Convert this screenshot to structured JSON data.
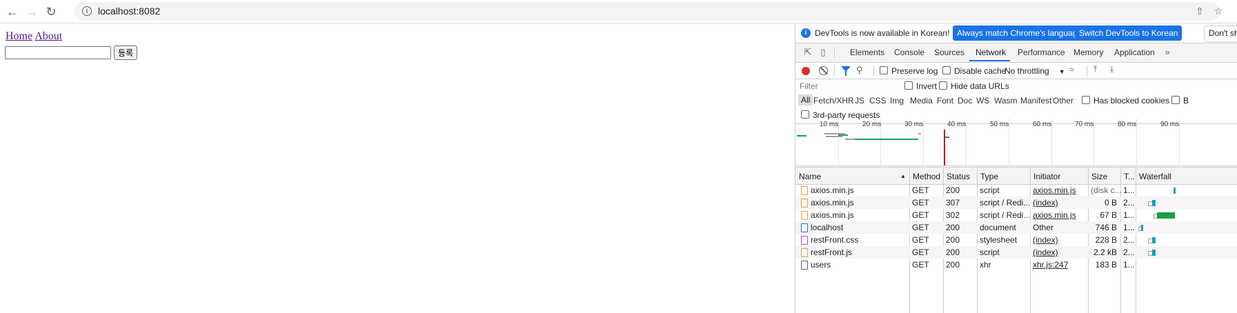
{
  "browser": {
    "url": "localhost:8082"
  },
  "page": {
    "links": [
      {
        "label": "Home"
      },
      {
        "label": "About"
      }
    ],
    "input_value": "",
    "submit_label": "등록"
  },
  "devtools": {
    "infobar": {
      "message": "DevTools is now available in Korean!",
      "btn_match": "Always match Chrome's language",
      "btn_switch": "Switch DevTools to Korean",
      "btn_dont": "Don't sh"
    },
    "tabs": [
      "Elements",
      "Console",
      "Sources",
      "Network",
      "Performance",
      "Memory",
      "Application"
    ],
    "active_tab": "Network",
    "toolbar": {
      "preserve_log": "Preserve log",
      "disable_cache": "Disable cache",
      "throttling": "No throttling"
    },
    "filter": {
      "placeholder": "Filter",
      "invert": "Invert",
      "hide_data_urls": "Hide data URLs"
    },
    "types": [
      "All",
      "Fetch/XHR",
      "JS",
      "CSS",
      "Img",
      "Media",
      "Font",
      "Doc",
      "WS",
      "Wasm",
      "Manifest",
      "Other"
    ],
    "has_blocked_cookies": "Has blocked cookies",
    "blocked_partial": "B",
    "third_party": "3rd-party requests",
    "timeline_ticks": [
      "10 ms",
      "20 ms",
      "30 ms",
      "40 ms",
      "50 ms",
      "60 ms",
      "70 ms",
      "80 ms",
      "90 ms"
    ],
    "columns": [
      "Name",
      "Method",
      "Status",
      "Type",
      "Initiator",
      "Size",
      "T...",
      "Waterfall"
    ],
    "rows": [
      {
        "name": "axios.min.js",
        "method": "GET",
        "status": "200",
        "type": "script",
        "initiator": "axios.min.js",
        "size": "(disk c...",
        "time": "1...",
        "icon": "script-file-icon"
      },
      {
        "name": "axios.min.js",
        "method": "GET",
        "status": "307",
        "type": "script / Redi...",
        "initiator": "(index)",
        "size": "0 B",
        "time": "2...",
        "icon": "script-file-icon"
      },
      {
        "name": "axios.min.js",
        "method": "GET",
        "status": "302",
        "type": "script / Redi...",
        "initiator": "axios.min.js",
        "size": "67 B",
        "time": "1...",
        "icon": "script-file-icon"
      },
      {
        "name": "localhost",
        "method": "GET",
        "status": "200",
        "type": "document",
        "initiator": "Other",
        "size": "746 B",
        "time": "1...",
        "icon": "document-file-icon"
      },
      {
        "name": "restFront.css",
        "method": "GET",
        "status": "200",
        "type": "stylesheet",
        "initiator": "(index)",
        "size": "228 B",
        "time": "2...",
        "icon": "stylesheet-file-icon"
      },
      {
        "name": "restFront.js",
        "method": "GET",
        "status": "200",
        "type": "script",
        "initiator": "(index)",
        "size": "2.2 kB",
        "time": "2...",
        "icon": "script-file-icon"
      },
      {
        "name": "users",
        "method": "GET",
        "status": "200",
        "type": "xhr",
        "initiator": "xhr.js:247",
        "size": "183 B",
        "time": "1...",
        "icon": "xhr-file-icon"
      }
    ]
  }
}
